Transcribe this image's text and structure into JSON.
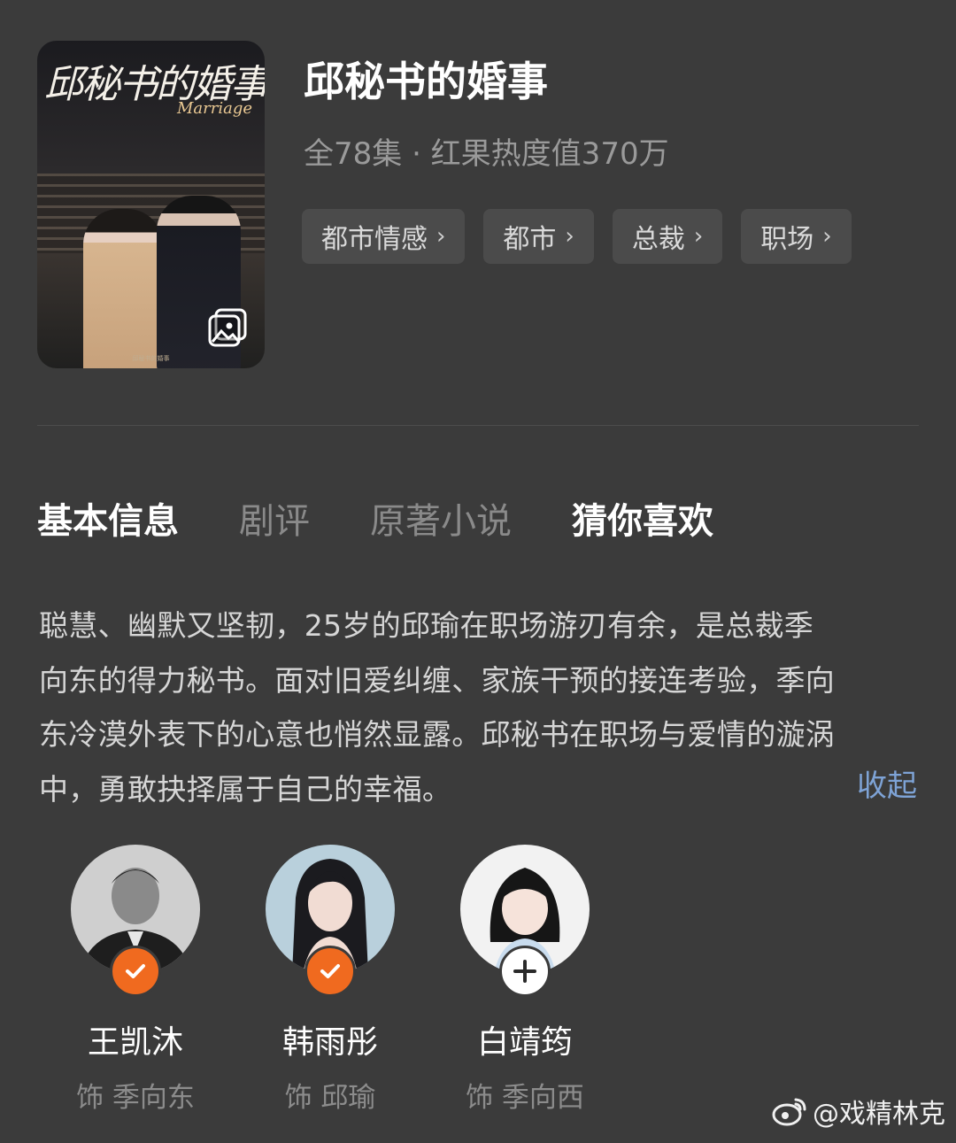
{
  "drama": {
    "title": "邱秘书的婚事",
    "meta": "全78集 · 红果热度值370万",
    "poster_title": "邱秘书的婚事",
    "poster_subtitle": "Marriage",
    "poster_caption": "邱秘书的婚事"
  },
  "tags": [
    {
      "label": "都市情感"
    },
    {
      "label": "都市"
    },
    {
      "label": "总裁"
    },
    {
      "label": "职场"
    }
  ],
  "tabs": [
    {
      "label": "基本信息",
      "active": true
    },
    {
      "label": "剧评",
      "active": false
    },
    {
      "label": "原著小说",
      "active": false
    },
    {
      "label": "猜你喜欢",
      "active": true
    }
  ],
  "description": {
    "lines": [
      "聪慧、幽默又坚韧，25岁的邱瑜在职场游刃有余，是总裁季",
      "向东的得力秘书。面对旧爱纠缠、家族干预的接连考验，季向",
      "东冷漠外表下的心意也悄然显露。邱秘书在职场与爱情的漩涡",
      "中，勇敢抉择属于自己的幸福。"
    ],
    "collapse_label": "收起"
  },
  "cast": [
    {
      "name": "王凯沐",
      "role": "饰 季向东",
      "status": "followed"
    },
    {
      "name": "韩雨彤",
      "role": "饰 邱瑜",
      "status": "followed"
    },
    {
      "name": "白靖筠",
      "role": "饰 季向西",
      "status": "follow"
    }
  ],
  "watermark": "@戏精林克",
  "colors": {
    "background": "#3b3b3b",
    "accent_orange": "#f06a1f",
    "link_blue": "#7ea3d6"
  }
}
